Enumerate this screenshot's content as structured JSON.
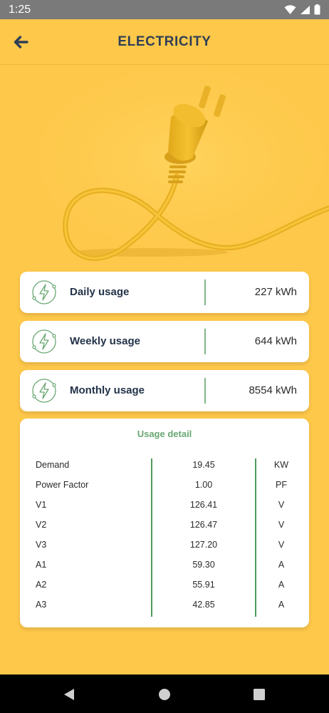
{
  "status_bar": {
    "time": "1:25",
    "icons": [
      "wifi-icon",
      "signal-icon",
      "battery-icon"
    ]
  },
  "header": {
    "title": "ELECTRICITY",
    "back_icon": "arrow-left-icon"
  },
  "hero": {
    "icon": "plug-icon"
  },
  "usage_cards": [
    {
      "label": "Daily usage",
      "value": "227 kWh",
      "icon": "lightning-icon"
    },
    {
      "label": "Weekly usage",
      "value": "644 kWh",
      "icon": "lightning-icon"
    },
    {
      "label": "Monthly usage",
      "value": "8554 kWh",
      "icon": "lightning-icon"
    }
  ],
  "usage_detail": {
    "title": "Usage detail",
    "rows": [
      {
        "label": "Demand",
        "value": "19.45",
        "unit": "KW"
      },
      {
        "label": "Power Factor",
        "value": "1.00",
        "unit": "PF"
      },
      {
        "label": "V1",
        "value": "126.41",
        "unit": "V"
      },
      {
        "label": "V2",
        "value": "126.47",
        "unit": "V"
      },
      {
        "label": "V3",
        "value": "127.20",
        "unit": "V"
      },
      {
        "label": "A1",
        "value": "59.30",
        "unit": "A"
      },
      {
        "label": "A2",
        "value": "55.91",
        "unit": "A"
      },
      {
        "label": "A3",
        "value": "42.85",
        "unit": "A"
      }
    ]
  },
  "nav_bar": {
    "icons": [
      "back-triangle-icon",
      "home-circle-icon",
      "recents-square-icon"
    ]
  },
  "colors": {
    "background": "#fec84a",
    "header_text": "#2f3e56",
    "accent_green": "#4f9a5c",
    "card": "#ffffff"
  }
}
